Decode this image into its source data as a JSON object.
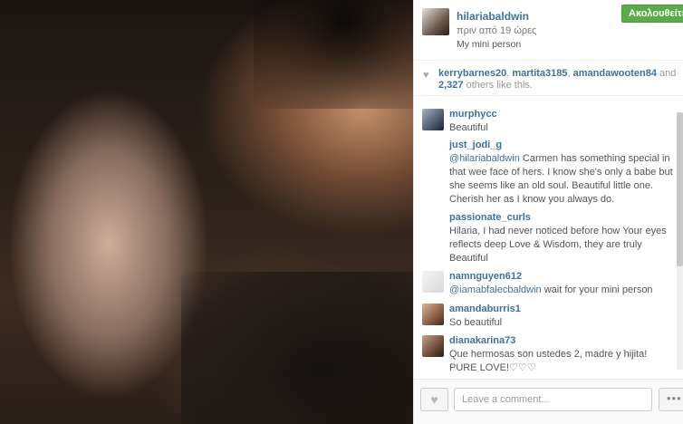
{
  "post": {
    "username": "hilariabaldwin",
    "time_ago": "πριν από 19 ώρες",
    "caption": "My mini person",
    "follow_label": "Ακολουθείτε"
  },
  "likes": {
    "users": [
      "kerrybarnes20",
      "martita3185",
      "amandawooten84"
    ],
    "separator": ", ",
    "and_text": " and",
    "others_count": "2,327",
    "others_text": " others like this."
  },
  "comments": [
    {
      "user": "murphycc",
      "text": "Beautiful"
    },
    {
      "user": "just_jodi_g",
      "mention": "@hilariabaldwin",
      "text": " Carmen has something special in that wee face of hers. I know she's only a babe but she seems like an old soul. Beautiful little one. Cherish her as I know you always do."
    },
    {
      "user": "passionate_curls",
      "text": "Hilaria, I had never noticed before how Your eyes reflects deep Love & Wisdom, they are truly Beautiful"
    },
    {
      "user": "namnguyen612",
      "mention": "@iamabfalecbaldwin",
      "text": " wait for your mini person"
    },
    {
      "user": "amandaburris1",
      "text": "So beautiful"
    },
    {
      "user": "dianakarina73",
      "text": "Que hermosas son ustedes 2, madre y hijita! PURE LOVE!♡♡♡"
    }
  ],
  "footer": {
    "comment_placeholder": "Leave a comment...",
    "like_icon": "heart-icon",
    "more_label": "•••"
  },
  "colors": {
    "link": "#3f729b",
    "follow_green": "#5aab4b"
  }
}
